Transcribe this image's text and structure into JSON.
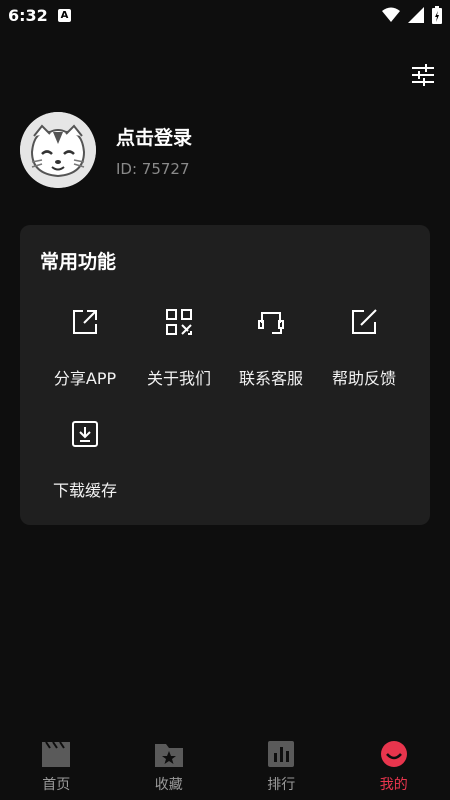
{
  "status": {
    "time": "6:32",
    "notif_letter": "A"
  },
  "profile": {
    "login_text": "点击登录",
    "user_id": "ID: 75727"
  },
  "card": {
    "title": "常用功能",
    "items": [
      {
        "label": "分享APP",
        "icon": "share-icon"
      },
      {
        "label": "关于我们",
        "icon": "qr-code-icon"
      },
      {
        "label": "联系客服",
        "icon": "headset-icon"
      },
      {
        "label": "帮助反馈",
        "icon": "edit-icon"
      },
      {
        "label": "下载缓存",
        "icon": "download-icon"
      }
    ]
  },
  "tabs": [
    {
      "label": "首页",
      "icon": "clapperboard-icon"
    },
    {
      "label": "收藏",
      "icon": "folder-star-icon"
    },
    {
      "label": "排行",
      "icon": "bar-chart-icon"
    },
    {
      "label": "我的",
      "icon": "smile-icon",
      "active": true
    }
  ],
  "colors": {
    "background": "#0e0e0e",
    "card": "#1f1f1f",
    "accent": "#e8354d",
    "muted": "#9a9a9a"
  }
}
